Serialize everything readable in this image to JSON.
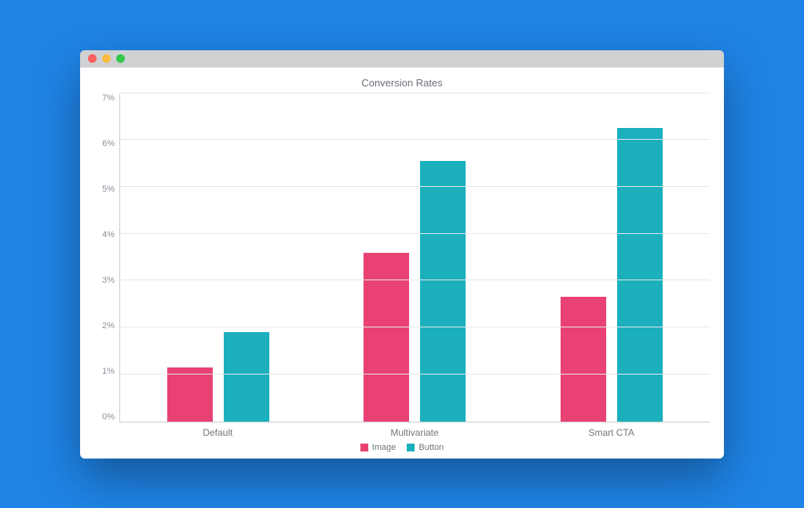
{
  "window": {
    "traffic_lights": [
      "close",
      "minimize",
      "zoom"
    ]
  },
  "chart_data": {
    "type": "bar",
    "title": "Conversion Rates",
    "categories": [
      "Default",
      "Multivariate",
      "Smart CTA"
    ],
    "series": [
      {
        "name": "Image",
        "values": [
          1.15,
          3.6,
          2.65
        ]
      },
      {
        "name": "Button",
        "values": [
          1.9,
          5.55,
          6.25
        ]
      }
    ],
    "ylabel": "",
    "xlabel": "",
    "ylim": [
      0,
      7
    ],
    "y_ticks": [
      "7%",
      "6%",
      "5%",
      "4%",
      "3%",
      "2%",
      "1%",
      "0%"
    ],
    "colors": {
      "Image": "#e94174",
      "Button": "#1bb0bc"
    }
  }
}
